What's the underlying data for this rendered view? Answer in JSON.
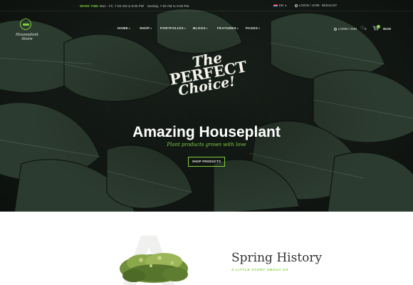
{
  "topbar": {
    "working": "WORK TIME",
    "hours_weekday": "Mon - Fri, 7:00 AM to 8:00 PM",
    "separator": "|",
    "hours_sunday": "Sunday, 7:00 AM to 5:00 PM",
    "language": "EN",
    "login": "LOGIN / JOIN",
    "wishlist": "WISHLIST"
  },
  "header": {
    "brand": "Houseplant Store",
    "nav": [
      {
        "label": "HOME",
        "chevron": "▾"
      },
      {
        "label": "SHOP",
        "chevron": "▾"
      },
      {
        "label": "PORTFOLIOS",
        "chevron": "▾"
      },
      {
        "label": "BLOGS",
        "chevron": "▾"
      },
      {
        "label": "FEATURES",
        "chevron": "▾"
      },
      {
        "label": "PAGES",
        "chevron": "▾"
      }
    ],
    "login": "LOGIN / JOIN",
    "wishlist_count": "0",
    "cart_count": "0",
    "cart_total": "$0.00"
  },
  "hero": {
    "badge_line1": "The",
    "badge_line2": "PERFECT",
    "badge_line3": "Choice!",
    "title": "Amazing Houseplant",
    "subtitle": "Plant products grown with love",
    "button": "SHOP PRODUCTS"
  },
  "about": {
    "watermark_letter": "A",
    "title": "Spring History",
    "subtitle": "A LITTLE STORY ABOUT US"
  },
  "colors": {
    "accent": "#7fcf3a",
    "hero_dark": "#141a16"
  },
  "icons": [
    "flag-icon",
    "user-icon",
    "heart-icon",
    "cart-icon",
    "chevron-down-icon",
    "logo-icon"
  ]
}
